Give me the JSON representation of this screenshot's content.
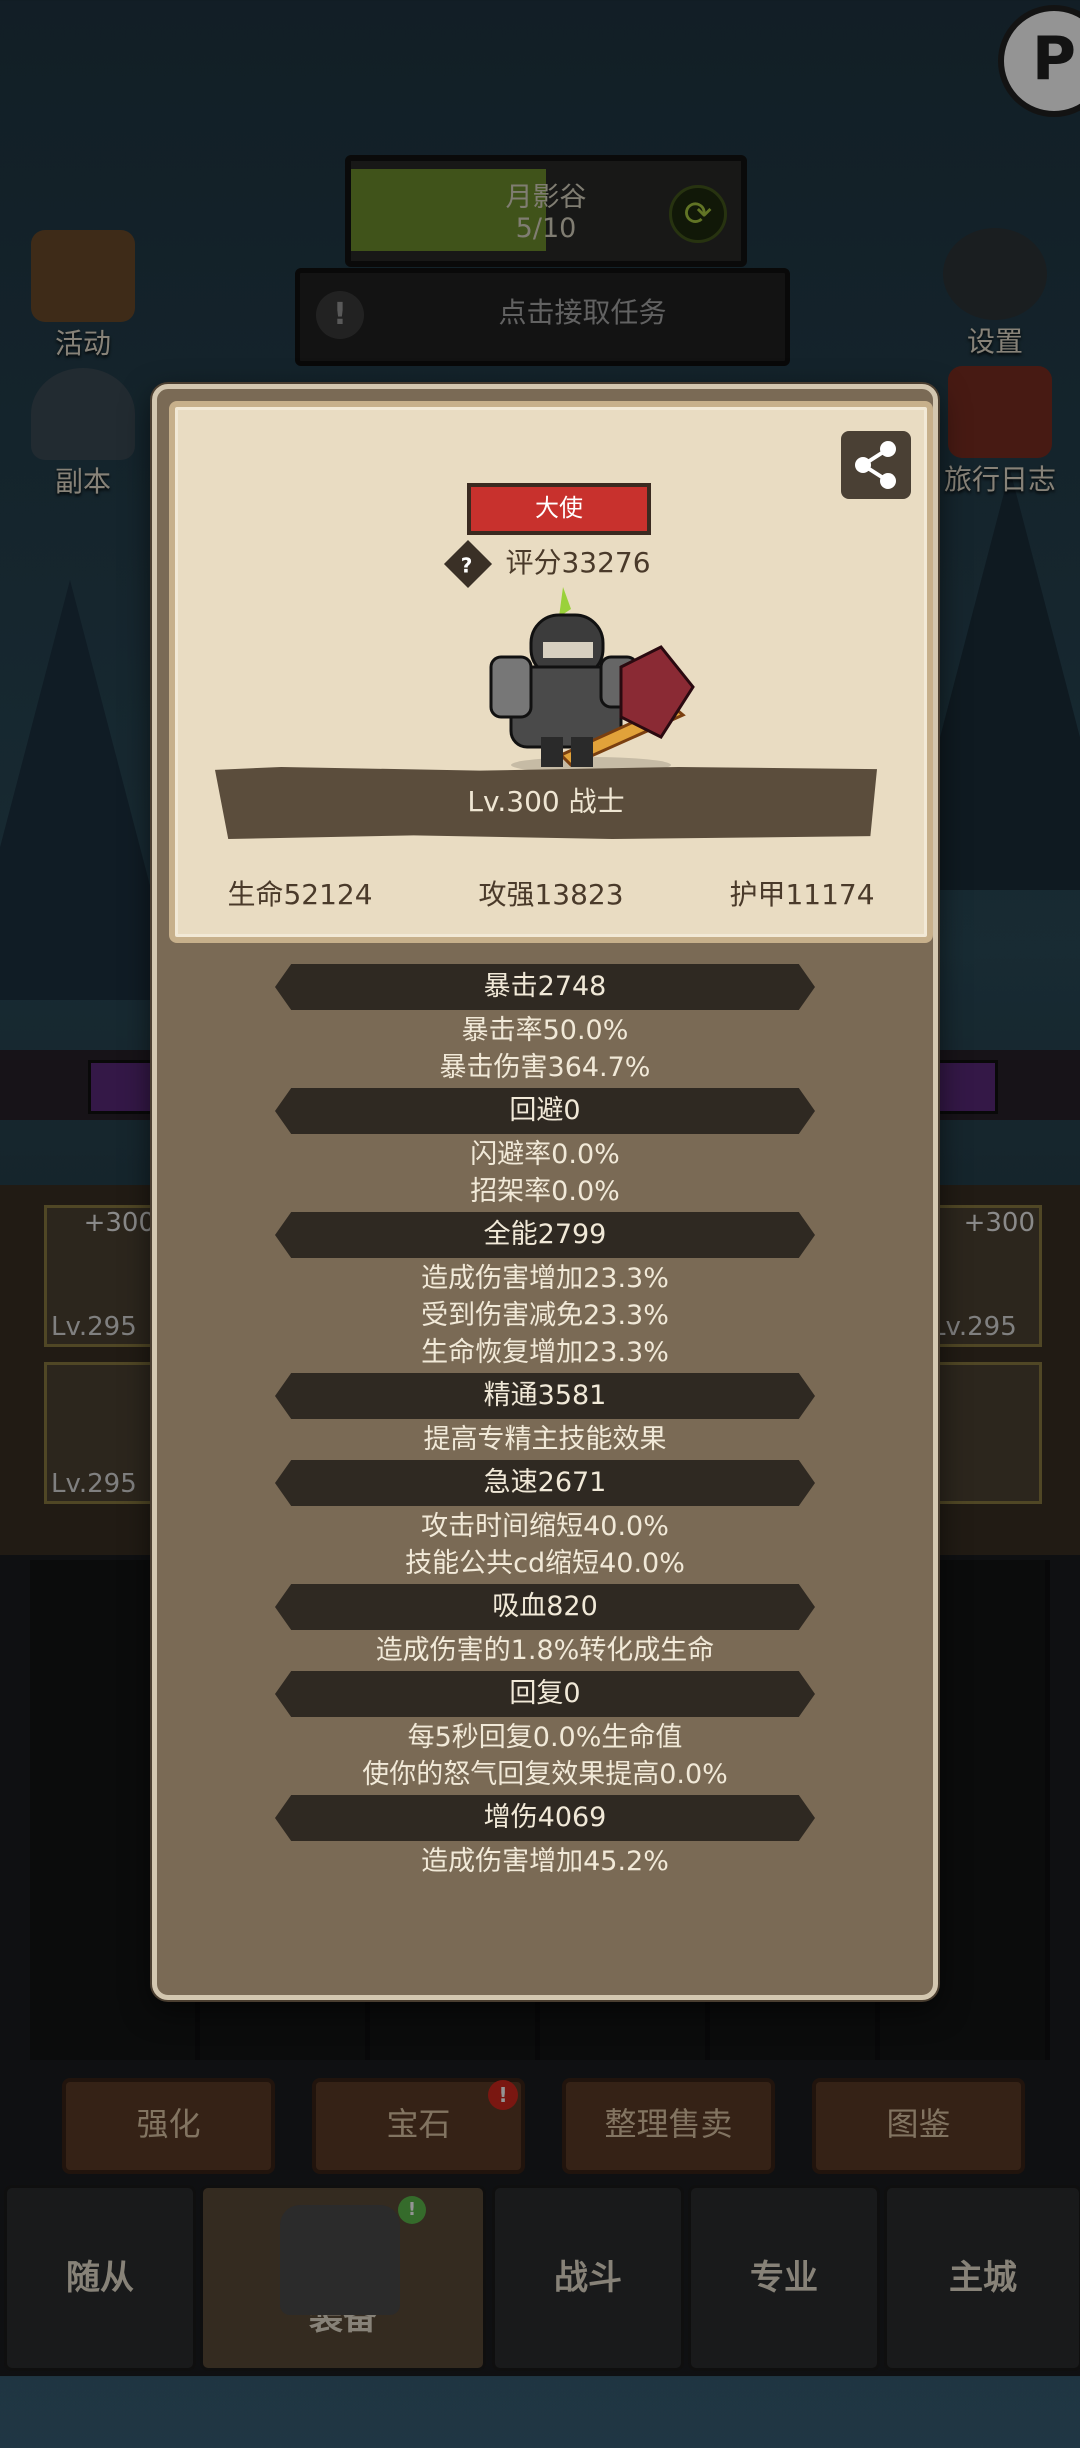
{
  "zone": {
    "name": "月影谷",
    "progress": "5/10",
    "progress_fraction": 0.5
  },
  "quest": {
    "text": "点击接取任务"
  },
  "left_menu": [
    {
      "label": "活动",
      "icon": "scroll-icon"
    },
    {
      "label": "副本",
      "icon": "portal-icon"
    }
  ],
  "right_menu": [
    {
      "label": "设置",
      "icon": "gear-icon"
    },
    {
      "label": "旅行日志",
      "icon": "journal-icon"
    }
  ],
  "panel": {
    "rank": "大使",
    "score": "评分33276",
    "level_class": "Lv.300 战士",
    "stats": {
      "hp": "生命52124",
      "attack": "攻强13823",
      "armor": "护甲11174"
    },
    "attributes": [
      {
        "header": "暴击2748",
        "lines": [
          "暴击率50.0%",
          "暴击伤害364.7%"
        ]
      },
      {
        "header": "回避0",
        "lines": [
          "闪避率0.0%",
          "招架率0.0%"
        ]
      },
      {
        "header": "全能2799",
        "lines": [
          "造成伤害增加23.3%",
          "受到伤害减免23.3%",
          "生命恢复增加23.3%"
        ]
      },
      {
        "header": "精通3581",
        "lines": [
          "提高专精主技能效果"
        ]
      },
      {
        "header": "急速2671",
        "lines": [
          "攻击时间缩短40.0%",
          "技能公共cd缩短40.0%"
        ]
      },
      {
        "header": "吸血820",
        "lines": [
          "造成伤害的1.8%转化成生命"
        ]
      },
      {
        "header": "回复0",
        "lines": [
          "每5秒回复0.0%生命值",
          "使你的怒气回复效果提高0.0%"
        ]
      },
      {
        "header": "增伤4069",
        "lines": [
          "造成伤害增加45.2%"
        ]
      }
    ]
  },
  "bg_equipment": {
    "slot_plus": "+300",
    "slot_level": "Lv.295"
  },
  "function_buttons": [
    "强化",
    "宝石",
    "整理售卖",
    "图鉴"
  ],
  "tabs": [
    "随从",
    "装备",
    "战斗",
    "专业",
    "主城"
  ],
  "colors": {
    "rank_red": "#c8312d",
    "zone_fill": "#6f8f2e",
    "panel_bg": "#7a6a55",
    "card_bg": "#e9dcc2"
  }
}
